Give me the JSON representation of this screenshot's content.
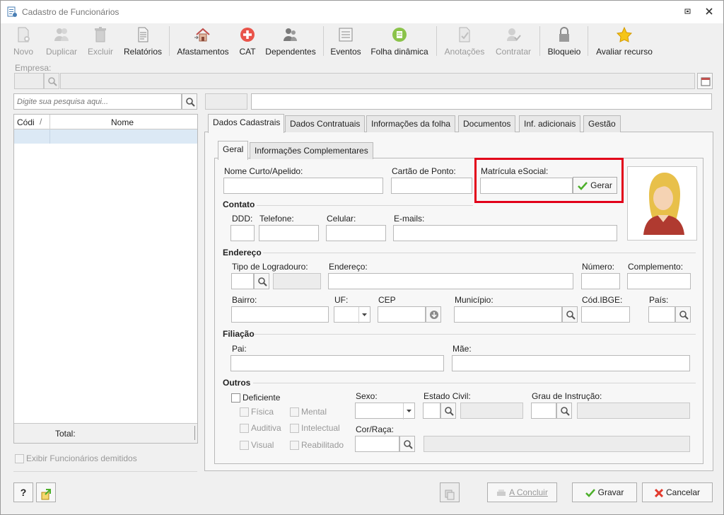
{
  "window": {
    "title": "Cadastro de Funcionários"
  },
  "toolbar": {
    "novo": "Novo",
    "duplicar": "Duplicar",
    "excluir": "Excluir",
    "relatorios": "Relatórios",
    "afastamentos": "Afastamentos",
    "cat": "CAT",
    "dependentes": "Dependentes",
    "eventos": "Eventos",
    "folha_dinamica": "Folha dinâmica",
    "anotacoes": "Anotações",
    "contratar": "Contratar",
    "bloqueio": "Bloqueio",
    "avaliar_recurso": "Avaliar recurso"
  },
  "empresa": {
    "label": "Empresa:"
  },
  "search": {
    "placeholder": "Digite sua pesquisa aqui..."
  },
  "grid": {
    "col_codigo": "Códi",
    "col_nome": "Nome",
    "total_label": "Total:"
  },
  "exibir_demitidos": "Exibir Funcionários demitidos",
  "tabs": [
    "Dados Cadastrais",
    "Dados Contratuais",
    "Informações da folha",
    "Documentos",
    "Inf. adicionais",
    "Gestão"
  ],
  "subtabs": [
    "Geral",
    "Informações Complementares"
  ],
  "form": {
    "nome_curto": "Nome Curto/Apelido:",
    "cartao_ponto": "Cartão de Ponto:",
    "matricula_esocial": "Matrícula eSocial:",
    "gerar": "Gerar",
    "contato": "Contato",
    "ddd": "DDD:",
    "telefone": "Telefone:",
    "celular": "Celular:",
    "emails": "E-mails:",
    "endereco_section": "Endereço",
    "tipo_logradouro": "Tipo de Logradouro:",
    "endereco": "Endereço:",
    "numero": "Número:",
    "complemento": "Complemento:",
    "bairro": "Bairro:",
    "uf": "UF:",
    "cep": "CEP",
    "municipio": "Município:",
    "cod_ibge": "Cód.IBGE:",
    "pais": "País:",
    "filiacao": "Filiação",
    "pai": "Pai:",
    "mae": "Mãe:",
    "outros": "Outros",
    "deficiente": "Deficiente",
    "fisica": "Física",
    "mental": "Mental",
    "auditiva": "Auditiva",
    "intelectual": "Intelectual",
    "visual": "Visual",
    "reabilitado": "Reabilitado",
    "sexo": "Sexo:",
    "estado_civil": "Estado Civil:",
    "grau_instrucao": "Grau de Instrução:",
    "cor_raca": "Cor/Raça:"
  },
  "footer": {
    "concluir": "A Concluir",
    "gravar": "Gravar",
    "cancelar": "Cancelar",
    "help": "?"
  },
  "colors": {
    "highlight": "#e2001a",
    "selected_row": "#dce9f5",
    "ok_green": "#4caf2a",
    "cancel_red": "#e23b2e"
  }
}
